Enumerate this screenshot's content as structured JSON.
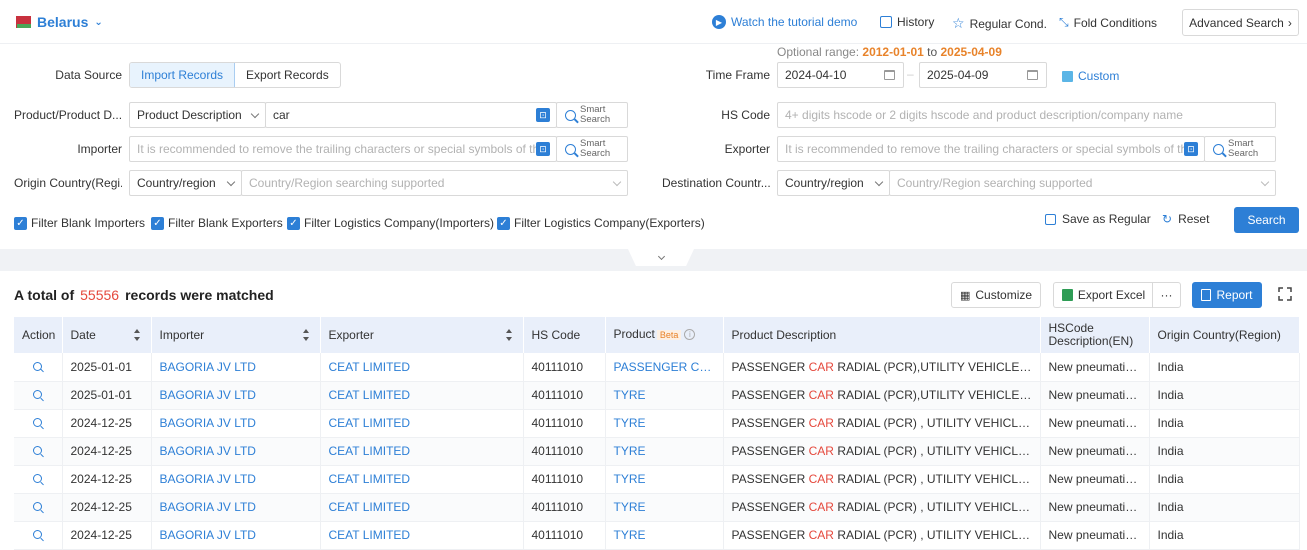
{
  "header": {
    "country": "Belarus",
    "tutorial": "Watch the tutorial demo",
    "history": "History",
    "regular_cond": "Regular Cond.",
    "fold": "Fold Conditions",
    "advanced": "Advanced Search"
  },
  "optional_range": {
    "label": "Optional range:",
    "start": "2012-01-01",
    "to": "to",
    "end": "2025-04-09"
  },
  "form": {
    "data_source_label": "Data Source",
    "import_records": "Import Records",
    "export_records": "Export Records",
    "time_frame_label": "Time Frame",
    "date_from": "2024-04-10",
    "date_to": "2025-04-09",
    "date_sep": "–",
    "custom": "Custom",
    "product_label": "Product/Product D...",
    "product_type": "Product Description",
    "product_value": "car",
    "smart_line1": "Smart",
    "smart_line2": "Search",
    "hs_label": "HS Code",
    "hs_placeholder": "4+ digits hscode or 2 digits hscode and product description/company name",
    "importer_label": "Importer",
    "importer_placeholder": "It is recommended to remove the trailing characters or special symbols of the...",
    "exporter_label": "Exporter",
    "exporter_placeholder": "It is recommended to remove the trailing characters or special symbols of the...",
    "origin_label": "Origin Country(Regi...",
    "dest_label": "Destination Countr...",
    "country_region": "Country/region",
    "country_placeholder": "Country/Region searching supported"
  },
  "filters": [
    "Filter Blank Importers",
    "Filter Blank Exporters",
    "Filter Logistics Company(Importers)",
    "Filter Logistics Company(Exporters)"
  ],
  "actions": {
    "save": "Save as Regular",
    "reset": "Reset",
    "search": "Search"
  },
  "results": {
    "prefix": "A total of",
    "count": "55556",
    "suffix": "records were matched",
    "customize": "Customize",
    "export_excel": "Export Excel",
    "more": "···",
    "report": "Report"
  },
  "table": {
    "columns": [
      "Action",
      "Date",
      "Importer",
      "Exporter",
      "HS Code",
      "Product",
      "Product Description",
      "HSCode Description(EN)",
      "Origin Country(Region)"
    ],
    "beta": "Beta",
    "rows": [
      {
        "date": "2025-01-01",
        "importer": "BAGORIA JV LTD",
        "exporter": "CEAT LIMITED",
        "hs": "40111010",
        "product": "PASSENGER CAR ...",
        "desc_pre": "PASSENGER ",
        "desc_hl": "CAR",
        "desc_post": " RADIAL (PCR),UTILITY VEHICLE RADIAL ...",
        "hsdesc": "New pneumatic t...",
        "origin": "India"
      },
      {
        "date": "2025-01-01",
        "importer": "BAGORIA JV LTD",
        "exporter": "CEAT LIMITED",
        "hs": "40111010",
        "product": "TYRE",
        "desc_pre": "PASSENGER ",
        "desc_hl": "CAR",
        "desc_post": " RADIAL (PCR),UTILITY VEHICLE RADIAL ...",
        "hsdesc": "New pneumatic t...",
        "origin": "India"
      },
      {
        "date": "2024-12-25",
        "importer": "BAGORIA JV LTD",
        "exporter": "CEAT LIMITED",
        "hs": "40111010",
        "product": "TYRE",
        "desc_pre": "PASSENGER ",
        "desc_hl": "CAR",
        "desc_post": " RADIAL (PCR) , UTILITY VEHICLE RADIA...",
        "hsdesc": "New pneumatic t...",
        "origin": "India"
      },
      {
        "date": "2024-12-25",
        "importer": "BAGORIA JV LTD",
        "exporter": "CEAT LIMITED",
        "hs": "40111010",
        "product": "TYRE",
        "desc_pre": "PASSENGER ",
        "desc_hl": "CAR",
        "desc_post": " RADIAL (PCR) , UTILITY VEHICLE RADIA...",
        "hsdesc": "New pneumatic t...",
        "origin": "India"
      },
      {
        "date": "2024-12-25",
        "importer": "BAGORIA JV LTD",
        "exporter": "CEAT LIMITED",
        "hs": "40111010",
        "product": "TYRE",
        "desc_pre": "PASSENGER ",
        "desc_hl": "CAR",
        "desc_post": " RADIAL (PCR) , UTILITY VEHICLE RADIA...",
        "hsdesc": "New pneumatic t...",
        "origin": "India"
      },
      {
        "date": "2024-12-25",
        "importer": "BAGORIA JV LTD",
        "exporter": "CEAT LIMITED",
        "hs": "40111010",
        "product": "TYRE",
        "desc_pre": "PASSENGER ",
        "desc_hl": "CAR",
        "desc_post": " RADIAL (PCR) , UTILITY VEHICLE RADIA...",
        "hsdesc": "New pneumatic t...",
        "origin": "India"
      },
      {
        "date": "2024-12-25",
        "importer": "BAGORIA JV LTD",
        "exporter": "CEAT LIMITED",
        "hs": "40111010",
        "product": "TYRE",
        "desc_pre": "PASSENGER ",
        "desc_hl": "CAR",
        "desc_post": " RADIAL (PCR) , UTILITY VEHICLE RADIA...",
        "hsdesc": "New pneumatic t...",
        "origin": "India"
      }
    ]
  },
  "colors": {
    "accent": "#2d7fd6",
    "highlight": "#e5483c",
    "range": "#e8832a"
  }
}
